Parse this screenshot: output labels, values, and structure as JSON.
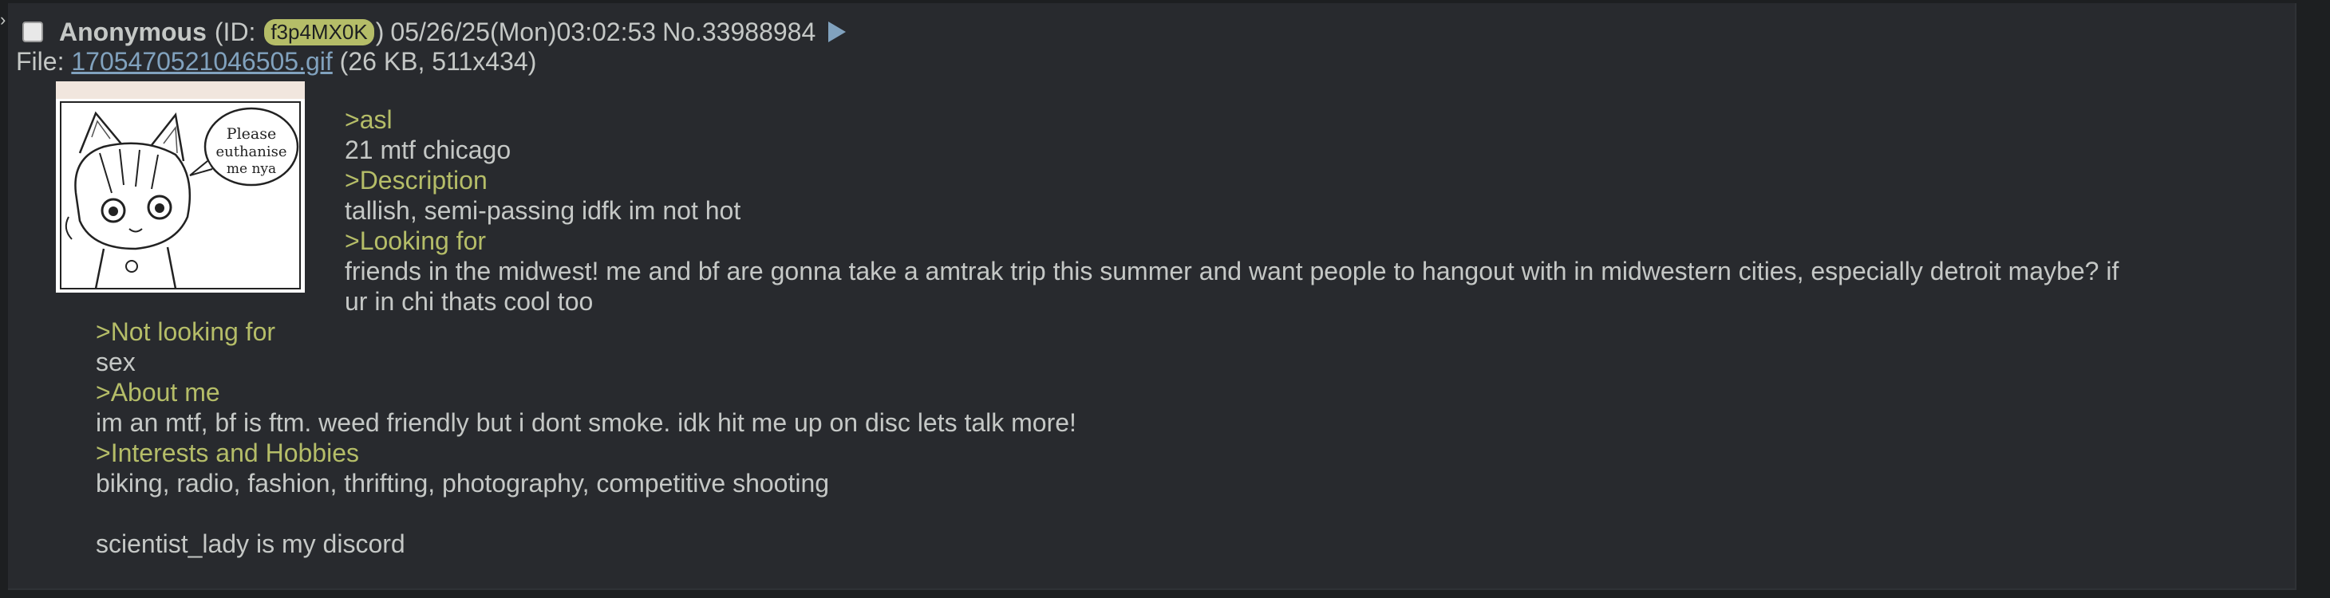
{
  "post": {
    "name": "Anonymous",
    "id_prefix": "(ID: ",
    "id": "f3p4MX0K",
    "id_suffix": ")",
    "date": "05/26/25(Mon)03:02:53",
    "post_no": "No.33988984",
    "file_prefix": "File: ",
    "file_name": "1705470521046505.gif",
    "file_meta": "(26 KB, 511x434)",
    "thumbnail_text": [
      "Please",
      "euthanise",
      "me nya"
    ]
  },
  "message": {
    "line1": ">asl",
    "line2": "21 mtf chicago",
    "line3": ">Description",
    "line4": "tallish, semi-passing idfk im not hot",
    "line5": ">Looking for",
    "line6": "friends in the midwest! me and bf are gonna take a amtrak trip this summer and want people to hangout with in midwestern cities, especially detroit maybe? if",
    "line7": "ur in chi thats cool too",
    "line8": ">Not looking for",
    "line9": "sex",
    "line10": ">About me",
    "line11": "im an mtf, bf is ftm. weed friendly but i dont smoke. idk hit me up on disc lets talk more!",
    "line12": ">Interests and Hobbies",
    "line13": "biking, radio, fashion, thrifting, photography, competitive shooting",
    "line14": "scientist_lady is my discord"
  },
  "colors": {
    "background": "#1d1f21",
    "post_background": "#282a2e",
    "text": "#c5c8c6",
    "greentext": "#b5bd68",
    "link": "#81a2be",
    "id_badge": "#b5bd68"
  }
}
